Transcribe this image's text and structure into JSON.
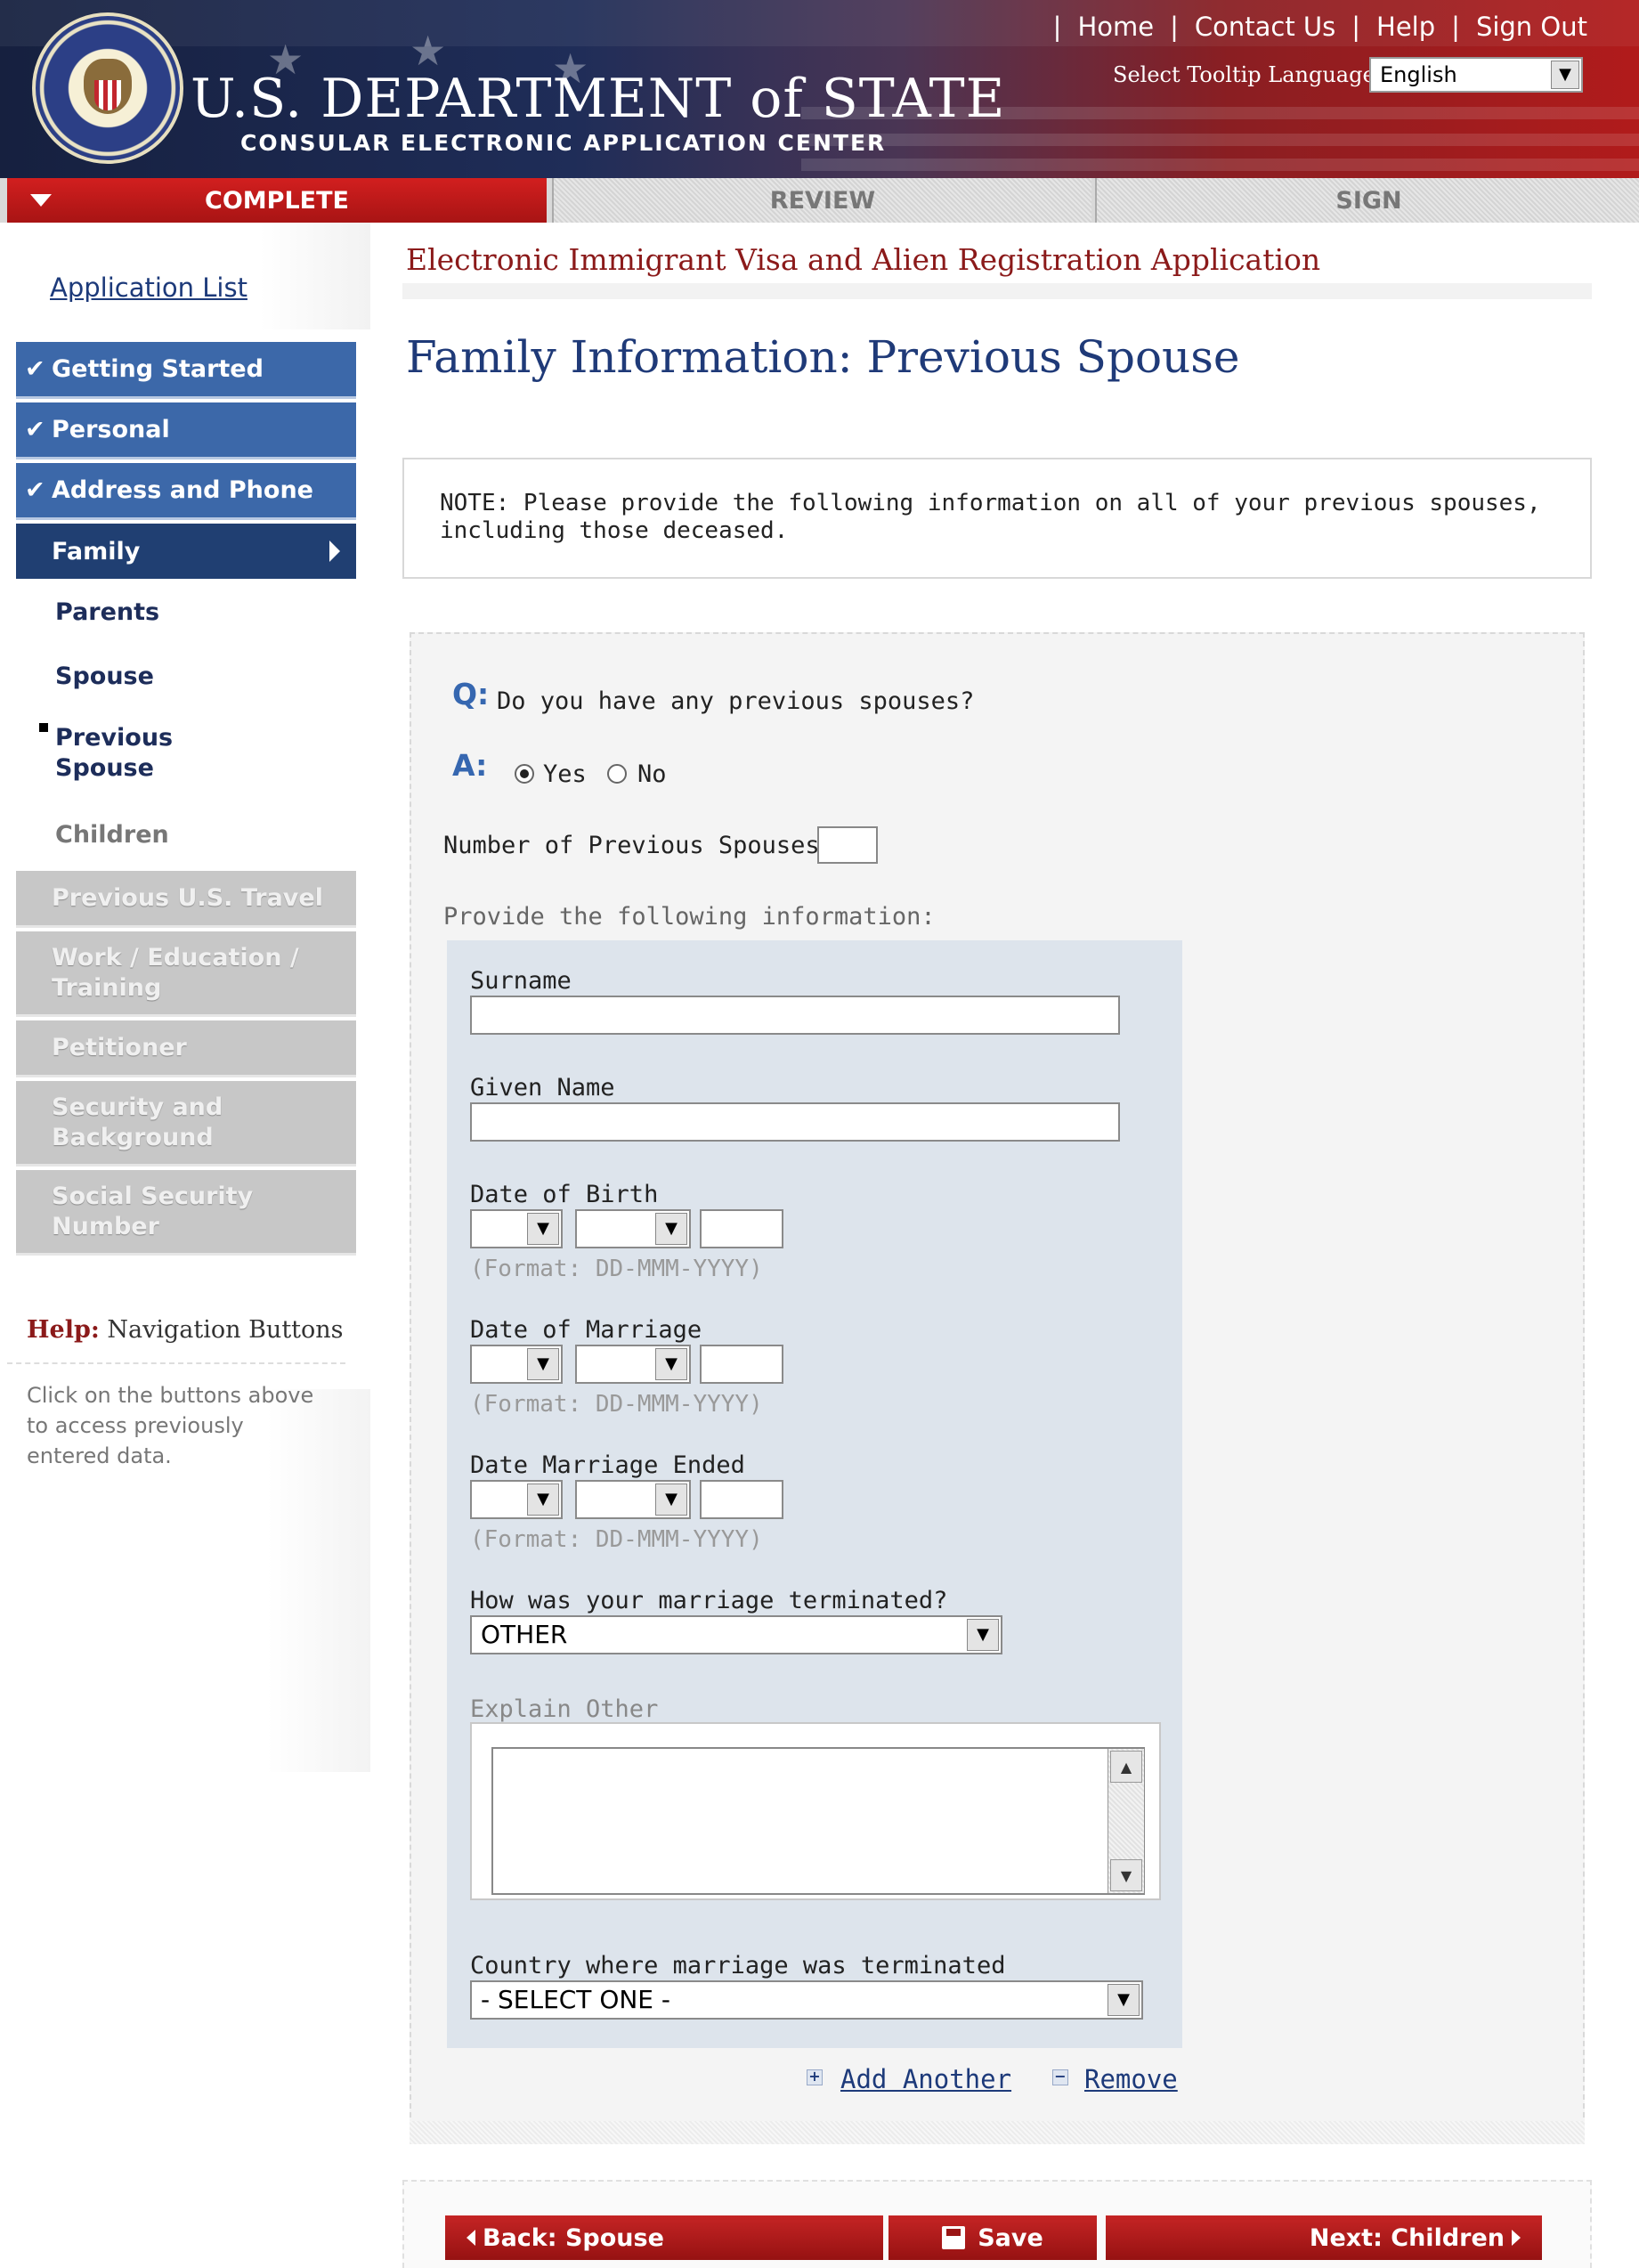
{
  "header": {
    "top_links": [
      "Home",
      "Contact Us",
      "Help",
      "Sign Out"
    ],
    "title": "U.S. DEPARTMENT of STATE",
    "subtitle": "CONSULAR ELECTRONIC APPLICATION CENTER",
    "tooltip_language_label": "Select Tooltip Language:",
    "tooltip_language_value": "English"
  },
  "steps": {
    "complete": "COMPLETE",
    "review": "REVIEW",
    "sign": "SIGN"
  },
  "sidebar": {
    "application_list": "Application List",
    "completed": [
      "Getting Started",
      "Personal",
      "Address and Phone"
    ],
    "active": "Family",
    "sub_items": [
      "Parents",
      "Spouse",
      "Previous Spouse",
      "Children"
    ],
    "disabled": [
      "Previous U.S. Travel",
      "Work / Education / Training",
      "Petitioner",
      "Security and Background",
      "Social Security Number"
    ],
    "help_title_prefix": "Help:",
    "help_title": "Navigation Buttons",
    "help_text": "Click on the buttons above to access previously entered data."
  },
  "main": {
    "app_heading": "Electronic Immigrant Visa and Alien Registration Application",
    "page_title": "Family Information: Previous Spouse",
    "note": "NOTE: Please provide the following information on all of your previous spouses, including those deceased.",
    "q_label": "Q:",
    "question": "Do you have any previous spouses?",
    "a_label": "A:",
    "answer_yes": "Yes",
    "answer_no": "No",
    "answer_selected": "Yes",
    "num_label": "Number of Previous Spouses:",
    "num_value": "",
    "provide_label": "Provide the following information:",
    "surname_label": "Surname",
    "surname_value": "",
    "given_label": "Given Name",
    "given_value": "",
    "dob_label": "Date of Birth",
    "dom_label": "Date of Marriage",
    "dme_label": "Date Marriage Ended",
    "date_format": "(Format: DD-MMM-YYYY)",
    "termination_label": "How was your marriage terminated?",
    "termination_value": "OTHER",
    "explain_label": "Explain Other",
    "explain_value": "",
    "country_label": "Country where marriage was terminated",
    "country_value": "- SELECT ONE -",
    "add_another": "Add Another",
    "remove": "Remove"
  },
  "buttons": {
    "back": "Back: Spouse",
    "save": "Save",
    "next": "Next: Children"
  },
  "colors": {
    "nav_done": "#3c68a9",
    "nav_active": "#203f72",
    "accent_red": "#b11b1b",
    "title_blue": "#1f3a78"
  }
}
